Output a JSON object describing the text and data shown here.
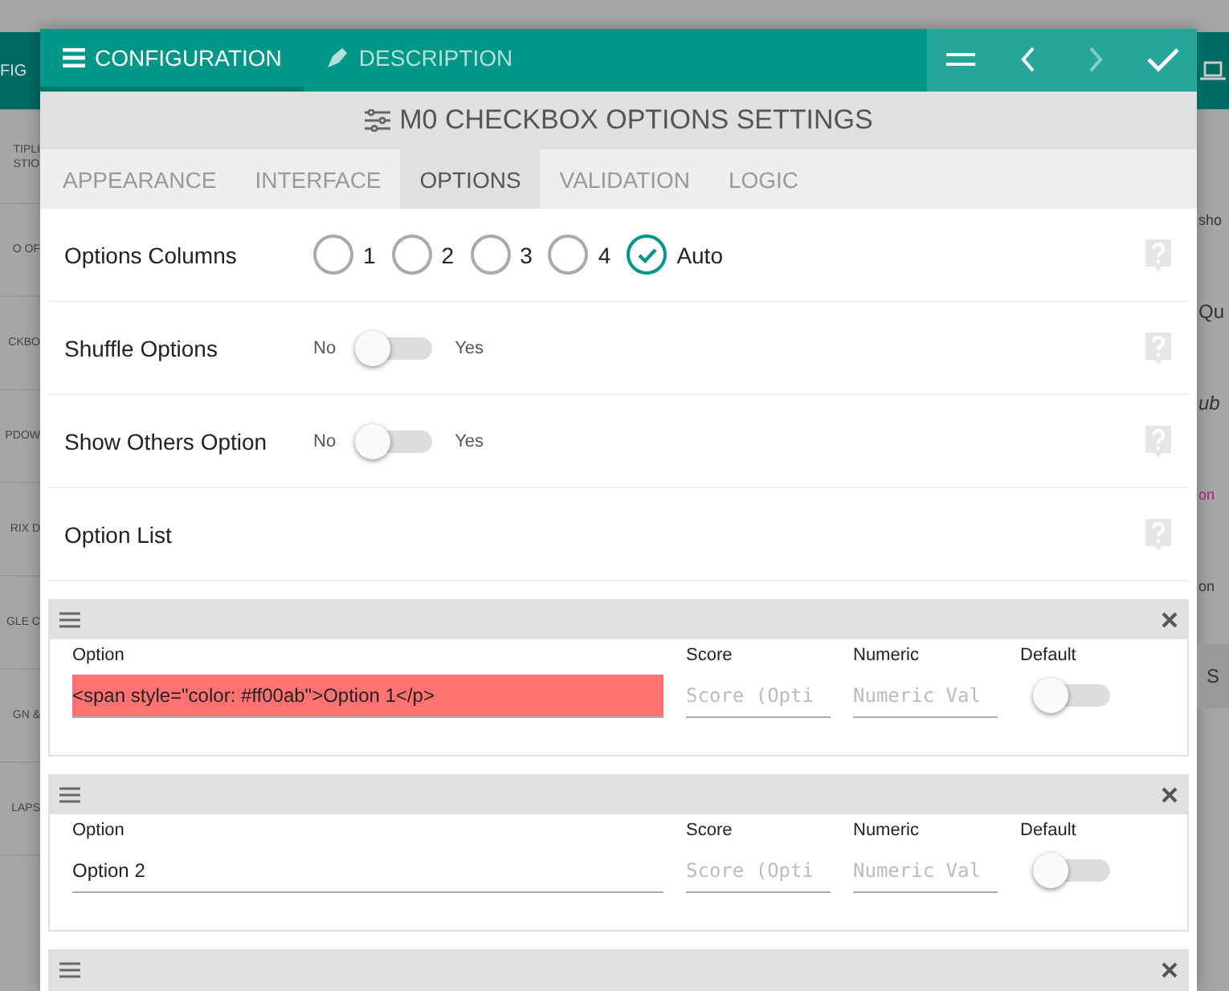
{
  "background": {
    "left_items": [
      {
        "text": "FIG",
        "kind": "header"
      },
      {
        "text": "TIPLI\nSTIO",
        "kind": "item"
      },
      {
        "text": "O OF",
        "kind": "item"
      },
      {
        "text": "CKBO",
        "kind": "item"
      },
      {
        "text": "PDOW",
        "kind": "item"
      },
      {
        "text": "RIX D",
        "kind": "item"
      },
      {
        "text": "GLE C",
        "kind": "item"
      },
      {
        "text": "GN &",
        "kind": "item"
      },
      {
        "text": "LAPS",
        "kind": "item"
      }
    ],
    "right_items": [
      {
        "text": "sho",
        "kind": "plain"
      },
      {
        "text": "Qu",
        "kind": "large"
      },
      {
        "text": "ub",
        "kind": "italic"
      },
      {
        "text": "on",
        "kind": "link"
      },
      {
        "text": "on",
        "kind": "plain"
      },
      {
        "text": "S",
        "kind": "button"
      }
    ]
  },
  "dialog": {
    "tabs": [
      {
        "label": "CONFIGURATION",
        "selected": true
      },
      {
        "label": "DESCRIPTION",
        "selected": false
      }
    ],
    "title": "M0 CHECKBOX OPTIONS SETTINGS",
    "subtabs": [
      {
        "label": "APPEARANCE",
        "selected": false
      },
      {
        "label": "INTERFACE",
        "selected": false
      },
      {
        "label": "OPTIONS",
        "selected": true
      },
      {
        "label": "VALIDATION",
        "selected": false
      },
      {
        "label": "LOGIC",
        "selected": false
      }
    ],
    "settings": [
      {
        "kind": "radio",
        "label": "Options Columns",
        "choices": [
          {
            "label": "1",
            "selected": false
          },
          {
            "label": "2",
            "selected": false
          },
          {
            "label": "3",
            "selected": false
          },
          {
            "label": "4",
            "selected": false
          },
          {
            "label": "Auto",
            "selected": true
          }
        ]
      },
      {
        "kind": "toggle",
        "label": "Shuffle Options",
        "off_label": "No",
        "on_label": "Yes",
        "on": false
      },
      {
        "kind": "toggle",
        "label": "Show Others Option",
        "off_label": "No",
        "on_label": "Yes",
        "on": false
      },
      {
        "kind": "plain",
        "label": "Option List"
      }
    ],
    "options": [
      {
        "fields": [
          {
            "label": "Option",
            "value": "<span style=\"color: #ff00ab\">Option 1</p>",
            "highlighted": true
          },
          {
            "label": "Score",
            "placeholder": "Score (Opti"
          },
          {
            "label": "Numeric",
            "placeholder": "Numeric Val"
          }
        ],
        "default_label": "Default",
        "default": false
      },
      {
        "fields": [
          {
            "label": "Option",
            "value": "Option 2",
            "highlighted": false
          },
          {
            "label": "Score",
            "placeholder": "Score (Opti"
          },
          {
            "label": "Numeric",
            "placeholder": "Numeric Val"
          }
        ],
        "default_label": "Default",
        "default": false
      },
      {
        "collapsed": true
      }
    ]
  }
}
